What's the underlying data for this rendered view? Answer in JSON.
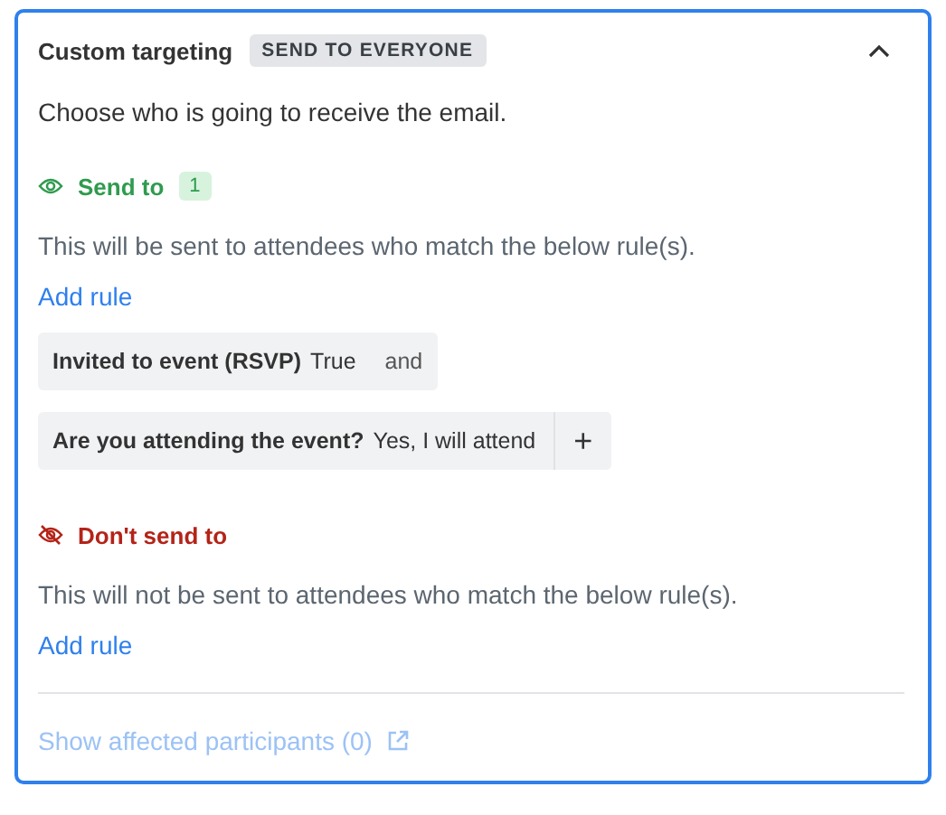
{
  "card": {
    "title": "Custom targeting",
    "badge": "SEND TO EVERYONE",
    "expanded": true,
    "intro": "Choose who is going to receive the email.",
    "sections": [
      {
        "kind": "include",
        "label": "Send to",
        "count": "1",
        "description": "This will be sent to attendees who match the below rule(s).",
        "add_rule": "Add rule",
        "rules": [
          {
            "field": "Invited to event (RSVP)",
            "value": "True",
            "connector": "and"
          },
          {
            "field": "Are you attending the event?",
            "value": "Yes, I will attend",
            "add_button": "+"
          }
        ]
      },
      {
        "kind": "exclude",
        "label": "Don't send to",
        "description": "This will not be sent to attendees who match the below rule(s).",
        "add_rule": "Add rule"
      }
    ],
    "footer_link": {
      "label": "Show affected participants (0)",
      "disabled": true
    }
  }
}
